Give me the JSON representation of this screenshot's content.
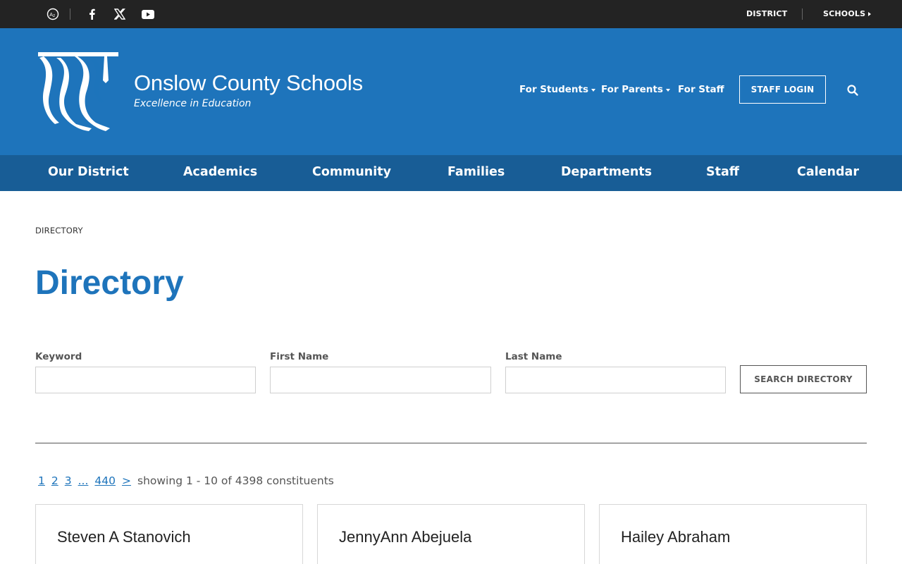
{
  "topbar": {
    "social": [
      "translate-icon",
      "facebook-icon",
      "x-icon",
      "youtube-icon"
    ],
    "district_label": "DISTRICT",
    "schools_label": "SCHOOLS"
  },
  "header": {
    "title": "Onslow County Schools",
    "tagline": "Excellence in Education",
    "quick_links": [
      {
        "label": "For Students"
      },
      {
        "label": "For Parents"
      },
      {
        "label": "For Staff"
      }
    ],
    "staff_login": "STAFF LOGIN"
  },
  "nav": {
    "items": [
      "Our District",
      "Academics",
      "Community",
      "Families",
      "Departments",
      "Staff",
      "Calendar"
    ]
  },
  "breadcrumb": "DIRECTORY",
  "page_title": "Directory",
  "search": {
    "keyword_label": "Keyword",
    "keyword_value": "",
    "first_label": "First Name",
    "first_value": "",
    "last_label": "Last Name",
    "last_value": "",
    "button": "SEARCH DIRECTORY"
  },
  "pagination": {
    "pages": [
      "1",
      "2",
      "3",
      "...",
      "440"
    ],
    "next": ">",
    "summary": "showing 1 - 10 of 4398 constituents"
  },
  "results": [
    {
      "name": "Steven A Stanovich"
    },
    {
      "name": "JennyAnn Abejuela"
    },
    {
      "name": "Hailey Abraham"
    }
  ],
  "colors": {
    "topbar": "#232323",
    "header": "#1e74bb",
    "nav": "#185d96",
    "accent": "#1e74bb"
  }
}
